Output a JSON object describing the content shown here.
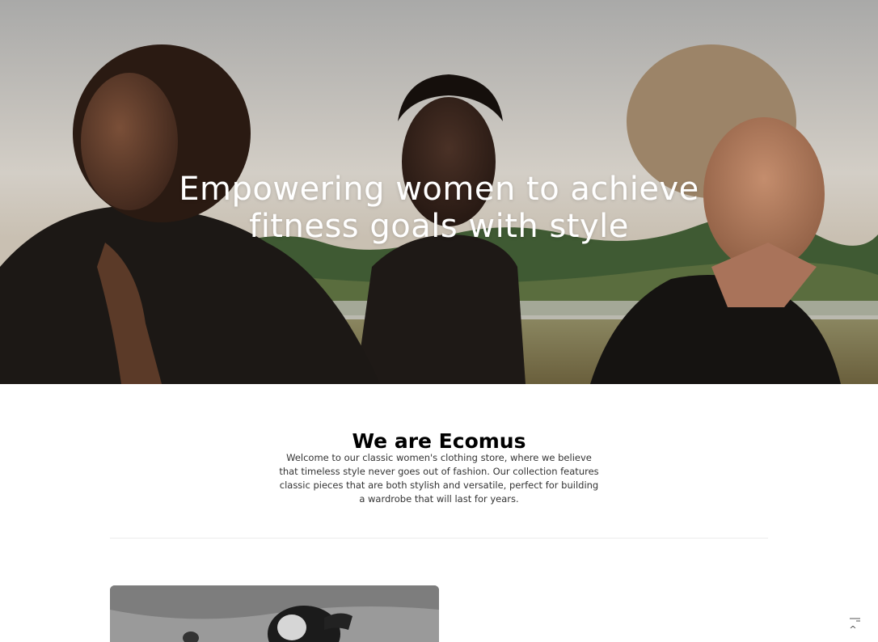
{
  "hero": {
    "title_line1": "Empowering women to achieve",
    "title_line2": "fitness goals with style",
    "image_subject": "three people in dark jackets standing in a field by a lake"
  },
  "about": {
    "heading": "We are Ecomus",
    "body": "Welcome to our classic women's clothing store, where we believe that timeless style never goes out of fashion. Our collection features classic pieces that are both stylish and versatile, perfect for building a wardrobe that will last for years."
  },
  "feature_image": {
    "subject": "black and white photo of a woman lying on sand"
  },
  "floating": {
    "menu_icon": "menu-lines-icon",
    "back_to_top_icon": "chevron-up-icon",
    "back_to_top_glyph": "^"
  },
  "colors": {
    "hero_text": "#ffffff",
    "heading": "#000000",
    "body_text": "#333333",
    "divider": "#ececec"
  }
}
